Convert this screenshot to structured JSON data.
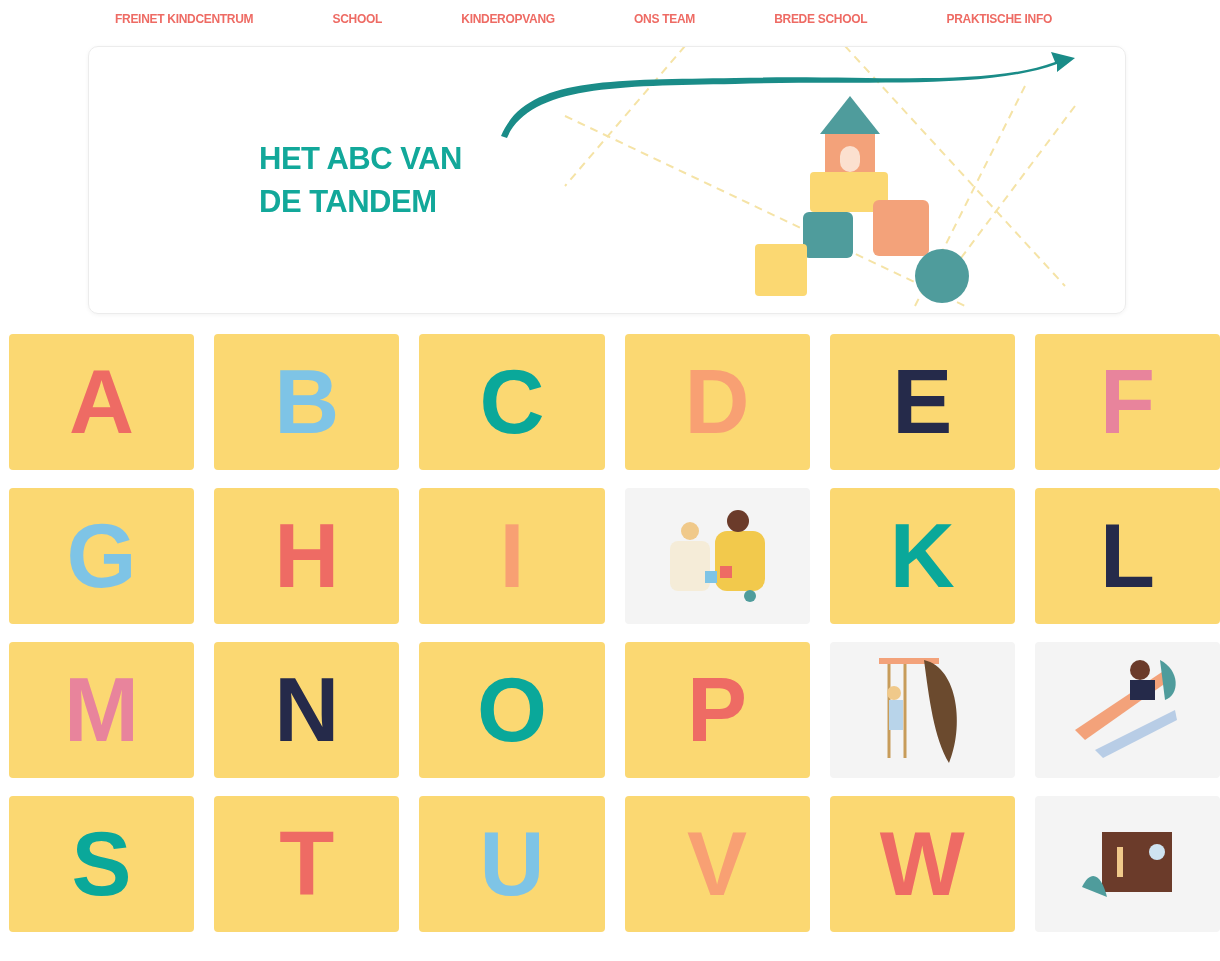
{
  "nav": [
    {
      "label": "FREINET KINDCENTRUM"
    },
    {
      "label": "SCHOOL"
    },
    {
      "label": "KINDEROPVANG"
    },
    {
      "label": "ONS TEAM"
    },
    {
      "label": "BREDE SCHOOL"
    },
    {
      "label": "PRAKTISCHE INFO"
    }
  ],
  "hero": {
    "title": "HET ABC VAN DE TANDEM"
  },
  "tiles": [
    {
      "kind": "letter",
      "letter": "A",
      "color": "#ee6b64"
    },
    {
      "kind": "letter",
      "letter": "B",
      "color": "#7ec4e6"
    },
    {
      "kind": "letter",
      "letter": "C",
      "color": "#0aa89a"
    },
    {
      "kind": "letter",
      "letter": "D",
      "color": "#f8a073"
    },
    {
      "kind": "letter",
      "letter": "E",
      "color": "#252a4a"
    },
    {
      "kind": "letter",
      "letter": "F",
      "color": "#e8849c"
    },
    {
      "kind": "letter",
      "letter": "G",
      "color": "#7ec4e6"
    },
    {
      "kind": "letter",
      "letter": "H",
      "color": "#ee6b64"
    },
    {
      "kind": "letter",
      "letter": "I",
      "color": "#f8a073"
    },
    {
      "kind": "illustration"
    },
    {
      "kind": "letter",
      "letter": "K",
      "color": "#0aa89a"
    },
    {
      "kind": "letter",
      "letter": "L",
      "color": "#252a4a"
    },
    {
      "kind": "letter",
      "letter": "M",
      "color": "#e8849c"
    },
    {
      "kind": "letter",
      "letter": "N",
      "color": "#252a4a"
    },
    {
      "kind": "letter",
      "letter": "O",
      "color": "#0aa89a"
    },
    {
      "kind": "letter",
      "letter": "P",
      "color": "#ee6b64"
    },
    {
      "kind": "illustration"
    },
    {
      "kind": "illustration"
    },
    {
      "kind": "letter",
      "letter": "S",
      "color": "#0aa89a"
    },
    {
      "kind": "letter",
      "letter": "T",
      "color": "#ee6b64"
    },
    {
      "kind": "letter",
      "letter": "U",
      "color": "#7ec4e6"
    },
    {
      "kind": "letter",
      "letter": "V",
      "color": "#f8a073"
    },
    {
      "kind": "letter",
      "letter": "W",
      "color": "#ee6b64"
    },
    {
      "kind": "illustration"
    }
  ]
}
